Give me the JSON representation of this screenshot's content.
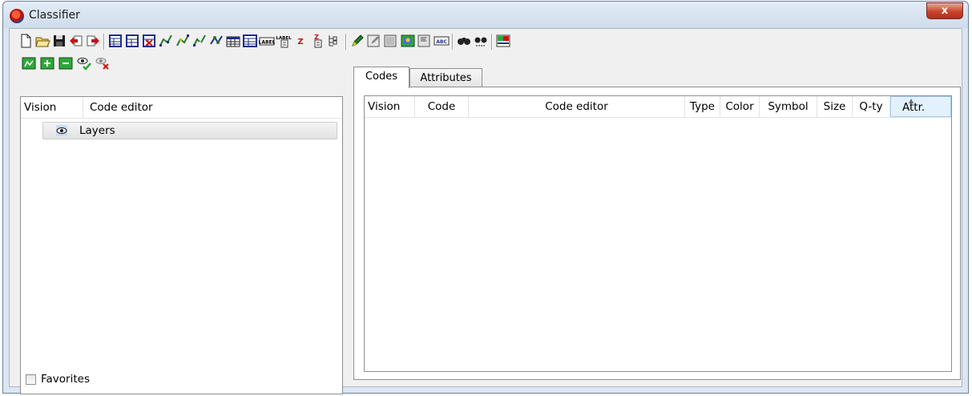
{
  "window": {
    "title": "Classifier",
    "close_glyph": "x"
  },
  "toolbar1": {
    "icons": [
      "new-document-icon",
      "open-folder-icon",
      "save-icon",
      "import-icon",
      "export-icon",
      "table-icon",
      "table-add-icon",
      "table-delete-icon",
      "polyline-icon",
      "polyline-edit-icon",
      "polyline-split-icon",
      "polyline-merge-icon",
      "grid-icon",
      "grid-large-icon",
      "label-icon",
      "label-text-icon",
      "z-icon",
      "z-text-icon",
      "tree-icon",
      "pencil-icon",
      "edit-layer-icon",
      "layer-icon",
      "layer-color-icon",
      "layer-flag-icon",
      "text-field-icon",
      "find-icon",
      "find-next-icon",
      "layer-properties-icon"
    ]
  },
  "toolbar2": {
    "icons": [
      "layer-icon",
      "layer-add-icon",
      "layer-remove-icon",
      "visibility-on-icon",
      "visibility-off-icon"
    ]
  },
  "left": {
    "columns": [
      "Vision",
      "Code editor"
    ],
    "tree": [
      {
        "icon": "eye-icon",
        "label": "Layers"
      }
    ],
    "favorites_label": "Favorites"
  },
  "tabs": [
    {
      "label": "Codes",
      "active": true
    },
    {
      "label": "Attributes",
      "active": false
    }
  ],
  "codes_table": {
    "columns": [
      "Vision",
      "Code",
      "Code editor",
      "Type",
      "Color",
      "Symbol",
      "Size",
      "Q-ty",
      "Attr."
    ],
    "sorted_column": "Attr."
  }
}
